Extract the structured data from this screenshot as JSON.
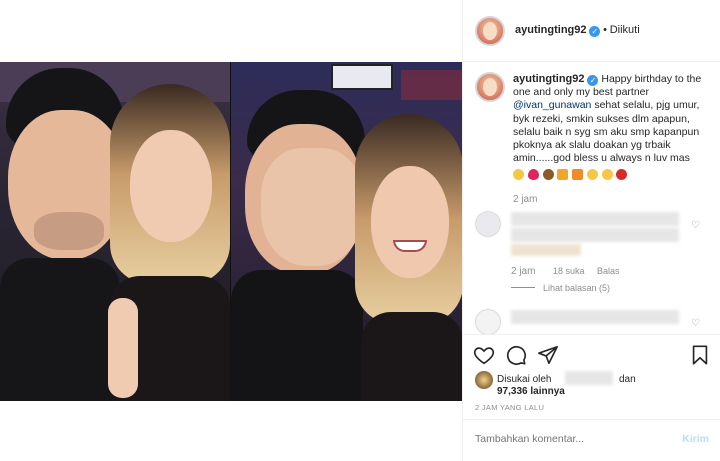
{
  "post": {
    "username": "ayutingting92",
    "verified_mark": "✓",
    "separator": "•",
    "follow_status": "Diikuti"
  },
  "caption": {
    "username": "ayutingting92",
    "text_before_mention": "Happy birthday to the one and only my best partner",
    "mention": "@ivan_gunawan",
    "text_after_mention": "sehat selalu, pjg umur, byk rezeki, smkin sukses dlm apapun, selalu baik n syg sm aku smp kapanpun pkoknya ak slalu doakan yg trbaik amin......god bless u always n luv mas",
    "emojis": [
      "smiling-face",
      "red-heart",
      "birthday-cake",
      "party-popper",
      "gift",
      "star-struck",
      "smiling-face-with-hearts",
      "santa"
    ],
    "time": "2 jam"
  },
  "comments": [
    {
      "time": "2 jam",
      "likes": "18 suka",
      "reply_label": "Balas",
      "view_replies": "Lihat balasan (5)"
    },
    {}
  ],
  "actions": {
    "like": "heart-outline-icon",
    "comment": "comment-bubble-icon",
    "share": "paper-plane-icon",
    "save": "bookmark-icon"
  },
  "likes": {
    "prefix": "Disukai oleh",
    "conjunction": "dan",
    "count": "97,336 lainnya"
  },
  "post_time": "2 JAM YANG LALU",
  "comment_box": {
    "placeholder": "Tambahkan komentar...",
    "post_label": "Kirim"
  },
  "colors": {
    "accent": "#3897f0",
    "heart": "#ed4956",
    "muted": "#8e8e8e",
    "post_btn_disabled": "#b2dffc"
  }
}
